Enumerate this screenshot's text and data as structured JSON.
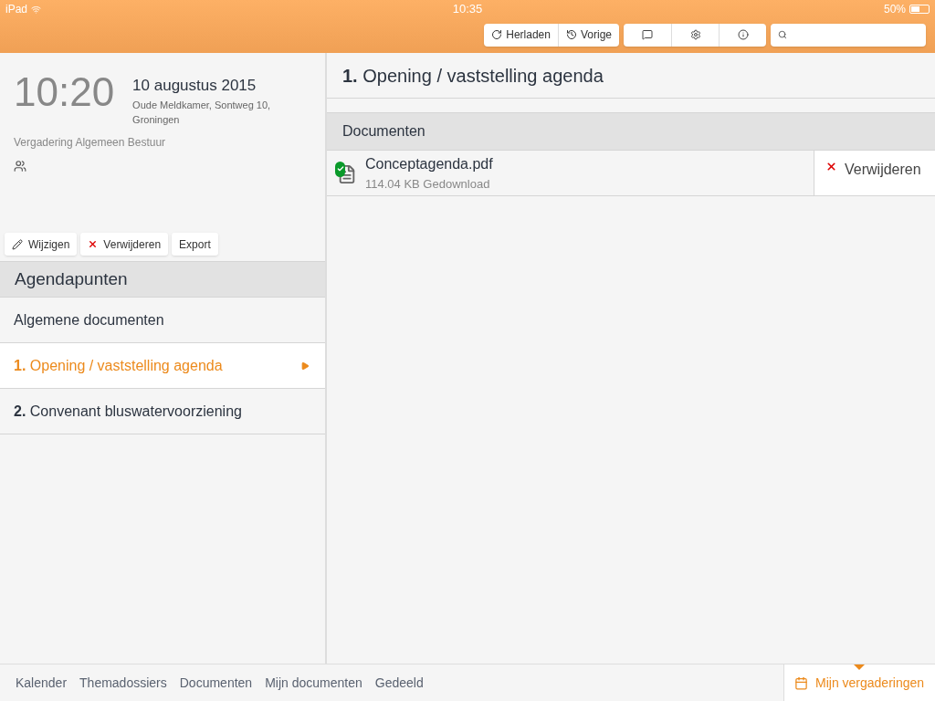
{
  "status_bar": {
    "device": "iPad",
    "time": "10:35",
    "battery": "50%"
  },
  "toolbar": {
    "buttons": [
      {
        "label": "Herladen",
        "kind": "reload"
      },
      {
        "label": "Vorige",
        "kind": "history"
      }
    ],
    "icon_buttons": [
      {
        "kind": "comment"
      },
      {
        "kind": "settings"
      },
      {
        "kind": "info"
      }
    ]
  },
  "meeting": {
    "time": "10:20",
    "date": "10 augustus 2015",
    "location": "Oude Meldkamer, Sontweg 10, Groningen",
    "title": "Vergadering Algemeen Bestuur",
    "actions": [
      {
        "label": "Wijzigen",
        "kind": "edit"
      },
      {
        "label": "Verwijderen",
        "kind": "delete"
      },
      {
        "label": "Export",
        "kind": "plain"
      }
    ]
  },
  "agenda": {
    "heading": "Agendapunten",
    "items": [
      {
        "label": "Algemene documenten",
        "selected": false
      },
      {
        "label": "**1.** Opening / vaststelling agenda",
        "selected": true
      },
      {
        "label": "**2.** Convenant bluswatervoorziening",
        "selected": false
      }
    ]
  },
  "detail": {
    "title": "**1.** Opening / vaststelling agenda",
    "section": "Documenten",
    "documents": [
      {
        "name": "Conceptagenda.pdf",
        "info": "114.04 KB Gedownload",
        "downloaded": true,
        "action": "Verwijderen"
      }
    ]
  },
  "bottom_nav": {
    "items": [
      {
        "label": "Kalender",
        "selected": false
      },
      {
        "label": "Themadossiers",
        "selected": false
      },
      {
        "label": "Documenten",
        "selected": false
      },
      {
        "label": "Mijn documenten",
        "selected": false
      },
      {
        "label": "Gedeeld",
        "selected": false
      }
    ],
    "my_meetings": {
      "label": "Mijn vergaderingen",
      "selected": true
    }
  }
}
